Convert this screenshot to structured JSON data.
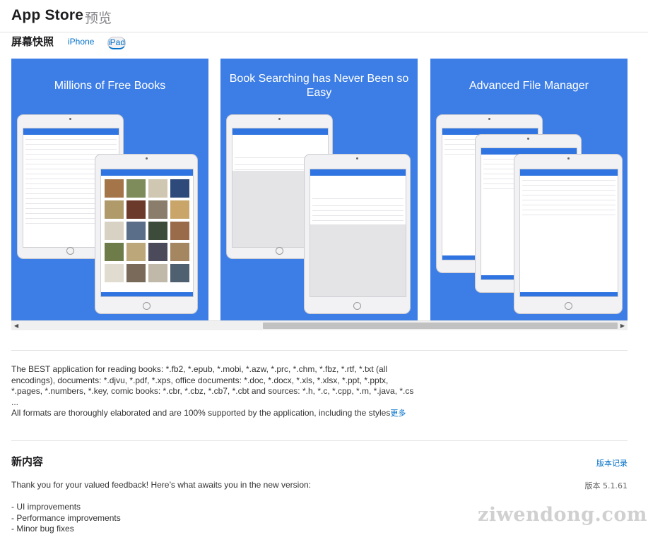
{
  "header": {
    "title": "App Store",
    "subtitle": "预览"
  },
  "screenshots": {
    "section_title": "屏幕快照",
    "tabs": [
      {
        "label": "iPhone",
        "active": false
      },
      {
        "label": "iPad",
        "active": true
      }
    ],
    "items": [
      {
        "caption": "Millions of Free Books"
      },
      {
        "caption": "Book Searching has Never Been so Easy"
      },
      {
        "caption": "Advanced File Manager"
      }
    ],
    "background_color": "#3d7ee6"
  },
  "scrollbar": {
    "left_arrow": "◀",
    "right_arrow": "▶"
  },
  "description": {
    "lines": [
      "The BEST application for reading books: *.fb2, *.epub, *.mobi, *.azw, *.prc, *.chm, *.fbz, *.rtf, *.txt (all",
      "encodings), documents: *.djvu, *.pdf, *.xps, office documents: *.doc, *.docx, *.xls, *.xlsx, *.ppt, *.pptx,",
      "*.pages, *.numbers, *.key, comic books: *.cbr, *.cbz, *.cb7, *.cbt and sources: *.h, *.c, *.cpp, *.m, *.java, *.cs",
      "...",
      "All formats are thoroughly elaborated and are 100% supported by the application, including the styles"
    ],
    "more_label": "更多"
  },
  "whats_new": {
    "title": "新内容",
    "history_label": "版本记录",
    "intro": "Thank you for your valued feedback! Here’s what awaits you in the new version:",
    "version": "版本 5.1.61",
    "notes": [
      "- UI improvements",
      "- Performance improvements",
      "- Minor bug fixes"
    ]
  },
  "watermark": "ziwendong.com",
  "colors": {
    "accent": "#0070c9",
    "screenshot_bg": "#3d7ee6",
    "app_bar": "#2f74e0"
  }
}
